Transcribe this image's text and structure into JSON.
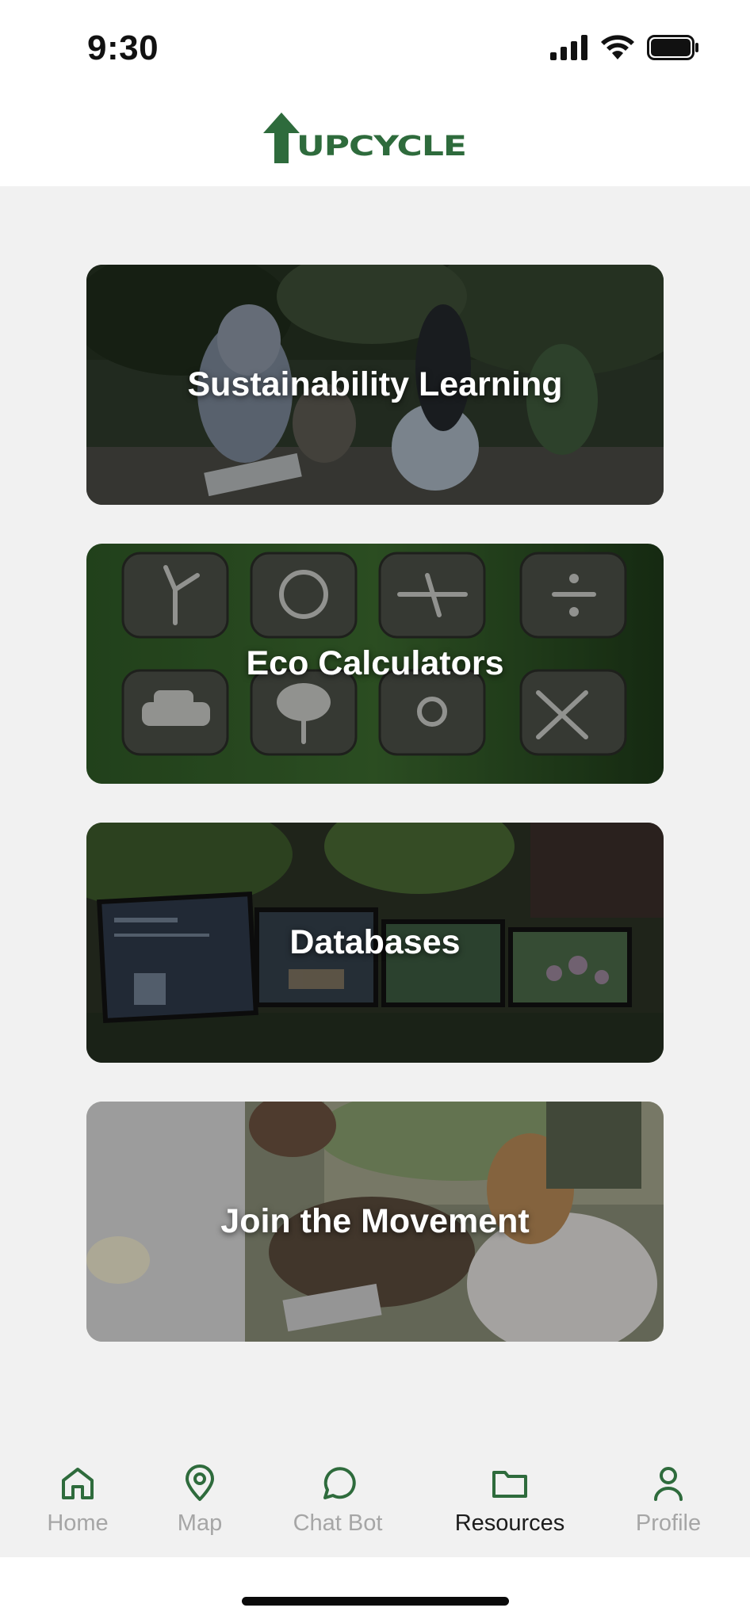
{
  "status_bar": {
    "time": "9:30"
  },
  "app": {
    "brand": "UPCYCLE",
    "brand_color": "#2e6b3c"
  },
  "cards": [
    {
      "title": "Sustainability Learning"
    },
    {
      "title": "Eco Calculators"
    },
    {
      "title": "Databases"
    },
    {
      "title": "Join the Movement"
    }
  ],
  "tab_bar": {
    "active": "Resources",
    "tabs": [
      {
        "label": "Home",
        "icon": "home-icon"
      },
      {
        "label": "Map",
        "icon": "map-pin-icon"
      },
      {
        "label": "Chat Bot",
        "icon": "chat-bubble-icon"
      },
      {
        "label": "Resources",
        "icon": "folder-icon"
      },
      {
        "label": "Profile",
        "icon": "person-icon"
      }
    ]
  },
  "colors": {
    "accent": "#2e6b3c",
    "background": "#f1f1f1",
    "inactive_tab": "#a6a6a6",
    "active_tab": "#1c1c1c"
  }
}
